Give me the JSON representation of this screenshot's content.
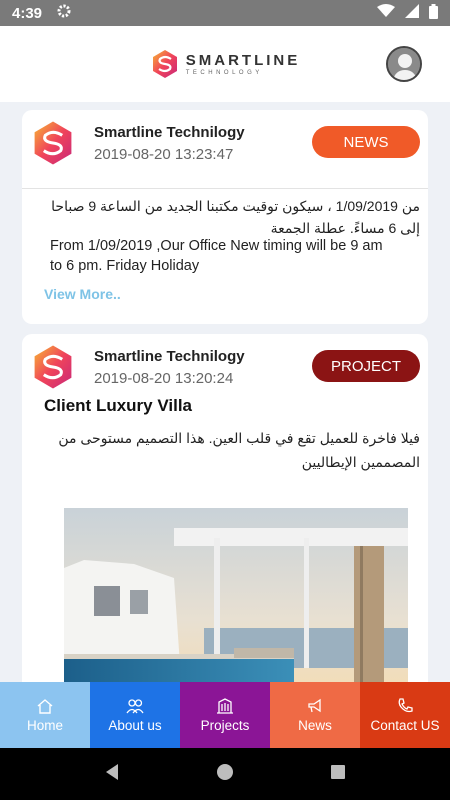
{
  "status_bar": {
    "time": "4:39"
  },
  "header": {
    "brand_name": "SMARTLINE",
    "brand_sub": "TECHNOLOGY"
  },
  "posts": [
    {
      "company": "Smartline Technilogy",
      "date": "2019-08-20 13:23:47",
      "badge": "NEWS",
      "arabic_line1": "من 1/09/2019 ، سيكون توقيت مكتبنا الجديد من الساعة 9 صباحا",
      "arabic_line2": "إلى 6 مساءً. عطلة الجمعة",
      "english_line1": "From  1/09/2019 ,Our Office New timing will be 9 am",
      "english_line2": "to 6 pm. Friday Holiday",
      "view_more": "View More.."
    },
    {
      "company": "Smartline Technilogy",
      "date": "2019-08-20 13:20:24",
      "badge": "PROJECT",
      "title": "Client Luxury Villa",
      "arabic_line1": "فيلا فاخرة للعميل تقع في قلب العين. هذا التصميم مستوحى من",
      "arabic_line2": "المصممين الإيطاليين"
    }
  ],
  "bottom_nav": [
    {
      "label": "Home",
      "icon": "home-icon"
    },
    {
      "label": "About us",
      "icon": "users-icon"
    },
    {
      "label": "Projects",
      "icon": "building-icon"
    },
    {
      "label": "News",
      "icon": "megaphone-icon"
    },
    {
      "label": "Contact US",
      "icon": "phone-icon"
    }
  ]
}
